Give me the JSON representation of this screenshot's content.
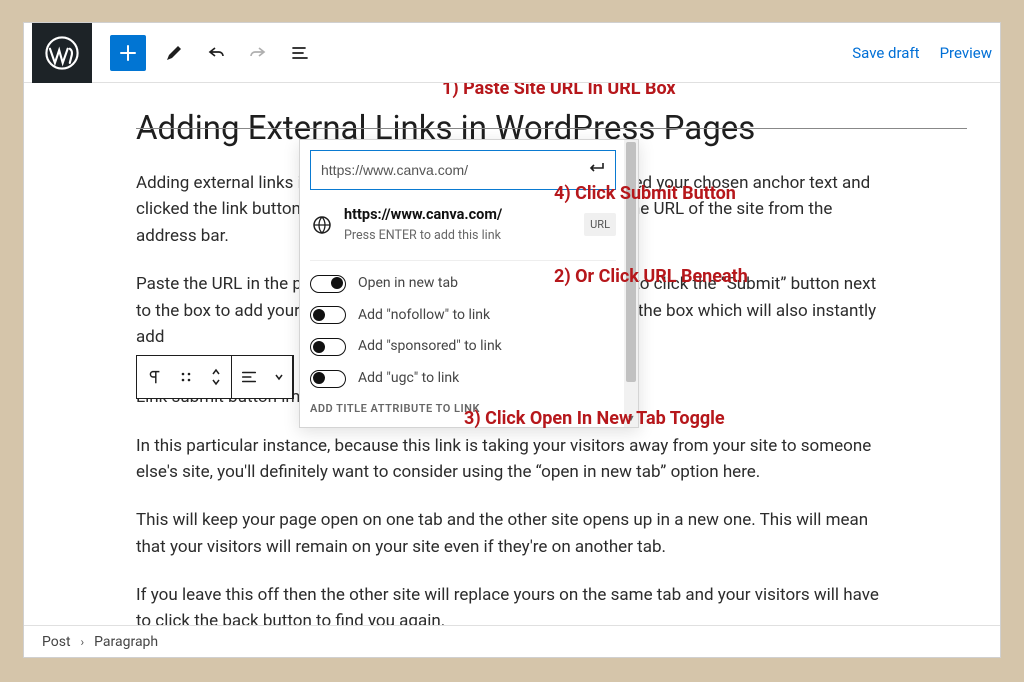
{
  "topbar": {
    "save_draft": "Save draft",
    "preview": "Preview"
  },
  "page": {
    "title": "Adding External Links in WordPress Pages",
    "p1": "Adding external links is no different really. Once you have highlighted your chosen anchor text and clicked the link button, go to the site you want to link to and copy the URL of the site from the address bar.",
    "p2": "Paste the URL in the pop-up text box as before. You will then need to click the “Submit” button next to the box to add your external link or you can click the url beneath the box which will also instantly add",
    "p3": "Link submit button image",
    "p4": "In this particular instance, because this link is taking your visitors away from your site to someone else's site, you'll definitely want to consider using the “open in new tab” option here.",
    "p5": "This will keep your page open on one tab and the other site opens up in a new one. This will mean that your visitors will remain on your site even if they're on another tab.",
    "p6": "If you leave this off then the other site will replace yours on the same tab and your visitors will have to click the back button to find you again."
  },
  "popover": {
    "url_value": "https://www.canva.com/",
    "suggest_url": "https://www.canva.com/",
    "suggest_hint": "Press ENTER to add this link",
    "badge": "URL",
    "options": [
      {
        "label": "Open in new tab",
        "on": true
      },
      {
        "label": "Add \"nofollow\" to link",
        "on": false
      },
      {
        "label": "Add \"sponsored\" to link",
        "on": false
      },
      {
        "label": "Add \"ugc\" to link",
        "on": false
      }
    ],
    "add_title": "ADD TITLE ATTRIBUTE TO LINK"
  },
  "annotations": {
    "a1": "1) Paste Site URL In URL Box",
    "a2": "2) Or Click URL Beneath",
    "a3": "3) Click Open In New Tab Toggle",
    "a4": "4) Click Submit Button"
  },
  "footer": {
    "crumb1": "Post",
    "crumb2": "Paragraph"
  }
}
